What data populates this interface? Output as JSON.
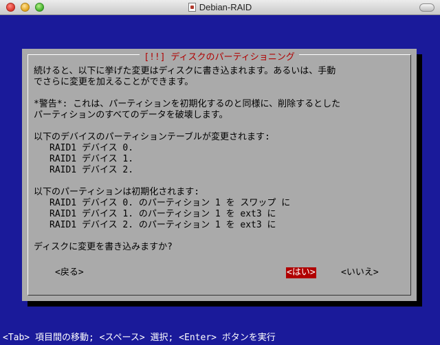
{
  "window": {
    "title": "Debian-RAID"
  },
  "dialog": {
    "title": "[!!] ディスクのパーティショニング",
    "paragraphs": {
      "p1_l1": "続けると、以下に挙げた変更はディスクに書き込まれます。あるいは、手動",
      "p1_l2": "でさらに変更を加えることができます。",
      "p2_l1": "*警告*: これは、パーティションを初期化するのと同様に、削除するとした",
      "p2_l2": "パーティションのすべてのデータを破壊します。",
      "p3_head": "以下のデバイスのパーティションテーブルが変更されます:",
      "p3_items": [
        "RAID1 デバイス 0.",
        "RAID1 デバイス 1.",
        "RAID1 デバイス 2."
      ],
      "p4_head": "以下のパーティションは初期化されます:",
      "p4_items": [
        "RAID1 デバイス 0. のパーティション 1 を スワップ に",
        "RAID1 デバイス 1. のパーティション 1 を ext3 に",
        "RAID1 デバイス 2. のパーティション 1 を ext3 に"
      ],
      "question": "ディスクに変更を書き込みますか?"
    },
    "buttons": {
      "back": "<戻る>",
      "yes": "<はい>",
      "no": "<いいえ>"
    }
  },
  "footer": {
    "hint": "<Tab> 項目間の移動; <スペース> 選択; <Enter> ボタンを実行"
  },
  "colors": {
    "background": "#1a1a9a",
    "dialog": "#aaaaaa",
    "accent": "#b00000"
  }
}
